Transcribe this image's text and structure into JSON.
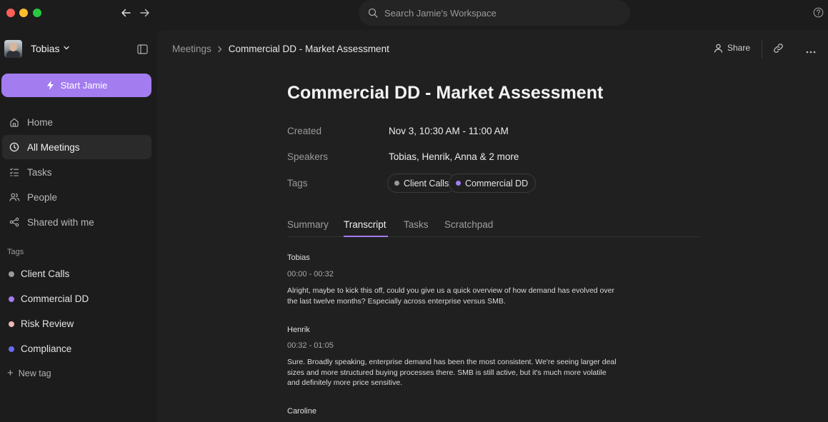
{
  "colors": {
    "accent": "#a37cf0",
    "tag_client_calls": "#9a9a9a",
    "tag_commercial_dd": "#a37cf0",
    "tag_risk_review": "#f0b6b6",
    "tag_compliance": "#6b6bf0"
  },
  "titlebar": {
    "search_placeholder": "Search Jamie's Workspace"
  },
  "sidebar": {
    "user_name": "Tobias",
    "start_label": "Start Jamie",
    "nav": [
      {
        "label": "Home",
        "icon": "home-icon"
      },
      {
        "label": "All Meetings",
        "icon": "clock-icon"
      },
      {
        "label": "Tasks",
        "icon": "tasks-icon"
      },
      {
        "label": "People",
        "icon": "people-icon"
      },
      {
        "label": "Shared with me",
        "icon": "share-icon"
      }
    ],
    "tags_heading": "Tags",
    "tags": [
      {
        "label": "Client Calls"
      },
      {
        "label": "Commercial DD"
      },
      {
        "label": "Risk Review"
      },
      {
        "label": "Compliance"
      }
    ],
    "new_tag_label": "New tag"
  },
  "main": {
    "breadcrumb": {
      "parent": "Meetings",
      "current": "Commercial DD - Market Assessment"
    },
    "share_label": "Share",
    "title": "Commercial DD - Market Assessment",
    "meta": {
      "created_label": "Created",
      "created_value": "Nov 3, 10:30 AM - 11:00 AM",
      "speakers_label": "Speakers",
      "speakers_value": "Tobias, Henrik, Anna & 2 more",
      "tags_label": "Tags",
      "tags": [
        "Client Calls",
        "Commercial DD"
      ]
    },
    "tabs": [
      "Summary",
      "Transcript",
      "Tasks",
      "Scratchpad"
    ],
    "active_tab": "Transcript",
    "transcript": [
      {
        "speaker": "Tobias",
        "time": "00:00 - 00:32",
        "lines": [
          "Alright, maybe to kick this off, could you give us a quick overview of how demand has evolved over",
          "the last twelve months? Especially across enterprise versus SMB."
        ]
      },
      {
        "speaker": "Henrik",
        "time": "00:32 - 01:05",
        "lines": [
          "Sure. Broadly speaking, enterprise demand has been the most consistent. We're seeing larger deal",
          "sizes and more structured buying processes there. SMB is still active, but it's much more volatile",
          "and definitely more price sensitive."
        ]
      },
      {
        "speaker": "Caroline"
      }
    ]
  }
}
